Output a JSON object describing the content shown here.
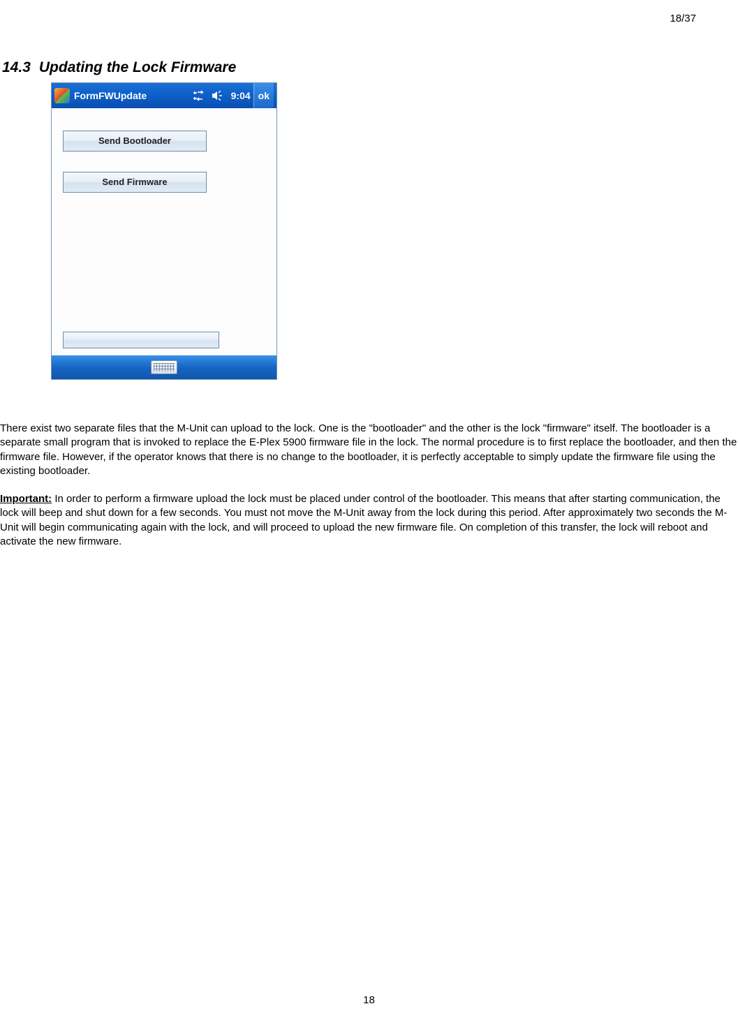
{
  "header": {
    "page_counter": "18/37"
  },
  "section": {
    "number": "14.3",
    "title": "Updating the Lock Firmware"
  },
  "screenshot": {
    "titlebar": {
      "app_title": "FormFWUpdate",
      "clock": "9:04",
      "ok": "ok"
    },
    "buttons": {
      "send_bootloader": "Send Bootloader",
      "send_firmware": "Send Firmware"
    }
  },
  "paragraphs": {
    "p1": "There exist two separate files that the M-Unit can upload to the lock. One is the \"bootloader\" and the other is the lock \"firmware\" itself. The bootloader is a separate small program that is invoked to replace the E-Plex 5900 firmware file in the lock. The normal procedure is to first replace the bootloader, and then the firmware file. However, if the operator knows that there is no change to the bootloader, it is perfectly acceptable to simply update the firmware file using the existing bootloader.",
    "important_label": "Important:",
    "p2_rest": "  In order to perform a firmware upload the lock must be placed under control of the bootloader. This means that after starting communication, the lock will beep and shut down for a few seconds. You must not move the M-Unit away from the lock during this period. After approximately two seconds the M-Unit will begin communicating again with the lock, and will proceed to upload the new firmware file. On completion of this transfer, the lock will reboot and activate the new firmware."
  },
  "footer": {
    "page_number": "18"
  }
}
